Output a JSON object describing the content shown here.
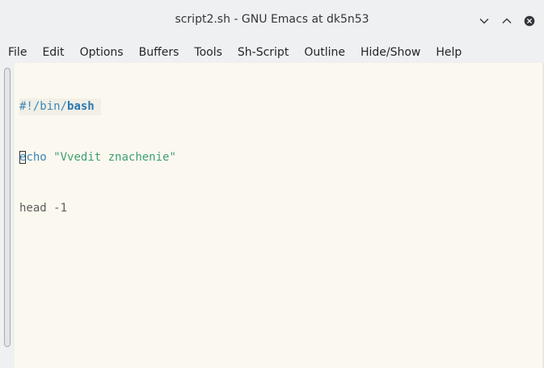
{
  "window": {
    "title": "script2.sh - GNU Emacs at dk5n53"
  },
  "titlebar_buttons": {
    "minimize_icon": "chevron-down-icon",
    "maximize_icon": "chevron-up-icon",
    "close_icon": "close-circle-icon"
  },
  "menu": {
    "items": [
      {
        "label": "File"
      },
      {
        "label": "Edit"
      },
      {
        "label": "Options"
      },
      {
        "label": "Buffers"
      },
      {
        "label": "Tools"
      },
      {
        "label": "Sh-Script"
      },
      {
        "label": "Outline"
      },
      {
        "label": "Hide/Show"
      },
      {
        "label": "Help"
      }
    ]
  },
  "editor": {
    "lines": [
      {
        "shebang_prefix": "#!/bin/",
        "shebang_bold": "bash"
      },
      {
        "cursor_char": "e",
        "builtin_rest": "cho",
        "space": " ",
        "string": "\"Vvedit znachenie\""
      },
      {
        "plain": "head -1"
      }
    ]
  },
  "colors": {
    "editor_bg": "#fbf8ef",
    "comment": "#3a87b8",
    "string": "#3f9f72",
    "text": "#5c5c5c"
  }
}
